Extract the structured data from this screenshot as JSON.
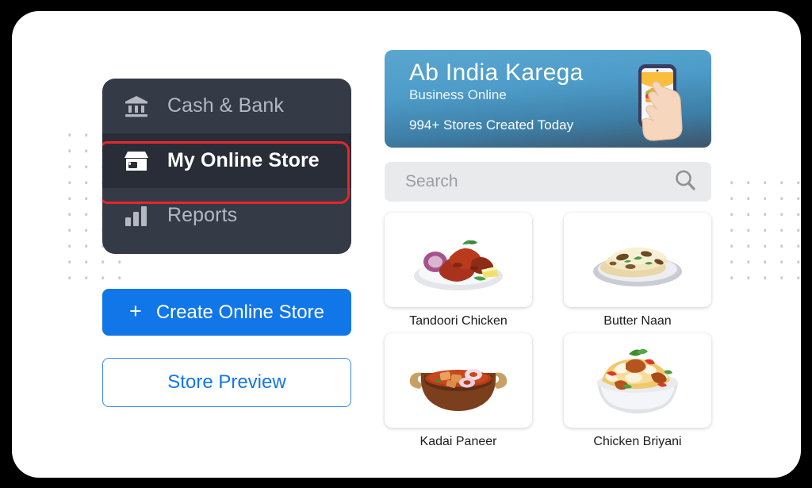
{
  "theme": {
    "page_background": "#000000",
    "card_background": "#ffffff",
    "sidebar_background": "#343a46",
    "sidebar_active_background": "#282d38",
    "highlight_border": "#e8242a",
    "accent_blue": "#1176e8",
    "banner_top": "#5aa6cf",
    "banner_bottom": "#3d5468",
    "search_background": "#e9eaec",
    "dot_color": "#c9ccd4"
  },
  "sidebar": {
    "items": [
      {
        "label": "Cash & Bank",
        "icon": "bank-icon",
        "active": false
      },
      {
        "label": "My Online Store",
        "icon": "store-icon",
        "active": true
      },
      {
        "label": "Reports",
        "icon": "bar-chart-icon",
        "active": false
      }
    ]
  },
  "actions": {
    "create_store_label": "Create Online Store",
    "create_store_plus": "+",
    "store_preview_label": "Store Preview"
  },
  "banner": {
    "title": "Ab India Karega",
    "subtitle": "Business Online",
    "stat": "994+ Stores Created Today",
    "illustration": "hand-holding-phone-burger-icon"
  },
  "search": {
    "value": "",
    "placeholder": "Search",
    "icon": "search-icon"
  },
  "products": [
    {
      "name": "Tandoori Chicken",
      "image": "tandoori-chicken-image"
    },
    {
      "name": "Butter Naan",
      "image": "butter-naan-image"
    },
    {
      "name": "Kadai Paneer",
      "image": "kadai-paneer-image"
    },
    {
      "name": "Chicken Briyani",
      "image": "chicken-briyani-image"
    }
  ],
  "decoration": {
    "left_dot_grid": {
      "columns": 4,
      "rows": 10
    },
    "right_dot_grid": {
      "columns": 6,
      "rows": 7
    }
  }
}
